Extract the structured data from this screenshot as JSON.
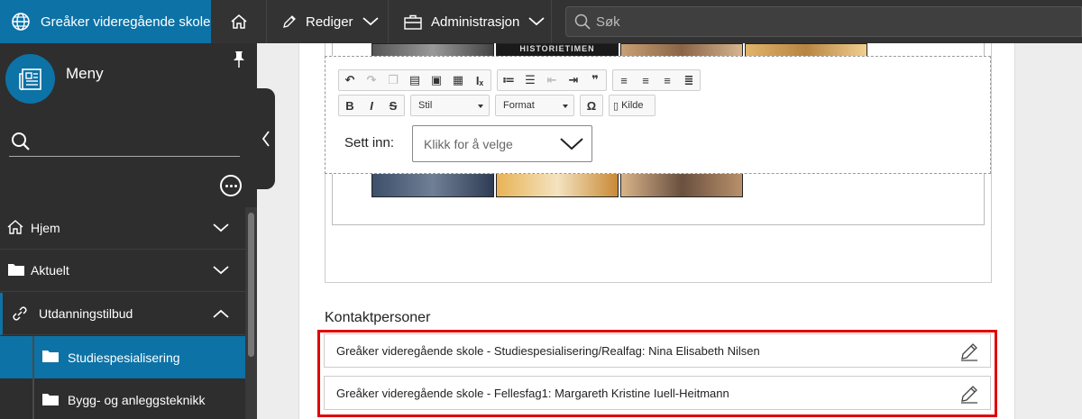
{
  "topbar": {
    "site_title": "Greåker videregående skole",
    "edit_label": "Rediger",
    "admin_label": "Administrasjon",
    "search_placeholder": "Søk",
    "brand_color": "#0d72a6"
  },
  "sidebar": {
    "menu_label": "Meny",
    "items": [
      {
        "label": "Hjem",
        "icon": "home-icon",
        "chevron": "down"
      },
      {
        "label": "Aktuelt",
        "icon": "folder-icon",
        "chevron": "down"
      },
      {
        "label": "Utdanningstilbud",
        "icon": "link-icon",
        "chevron": "up"
      },
      {
        "label": "Studiespesialisering",
        "icon": "folder-icon",
        "selected": true
      },
      {
        "label": "Bygg- og anleggsteknikk",
        "icon": "folder-icon"
      }
    ]
  },
  "editor": {
    "style_combo": "Stil",
    "format_combo": "Format",
    "source_button": "Kilde",
    "insert_label": "Sett inn:",
    "insert_placeholder": "Klikk for å velge",
    "photo_banner_text": "HISTORIETIMEN"
  },
  "contacts": {
    "title": "Kontaktpersoner",
    "items": [
      "Greåker videregående skole - Studiespesialisering/Realfag: Nina Elisabeth Nilsen",
      "Greåker videregående skole - Fellesfag1: Margareth Kristine Iuell-Heitmann"
    ],
    "highlight_color": "#e00000"
  }
}
